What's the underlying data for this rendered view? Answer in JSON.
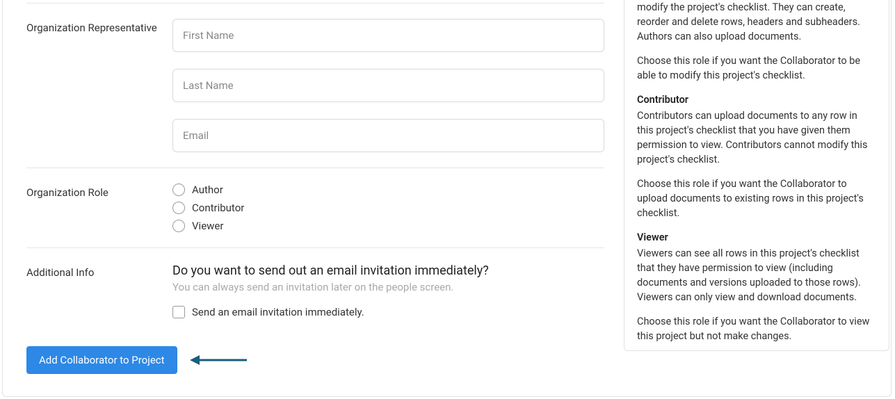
{
  "form": {
    "representative": {
      "label": "Organization Representative",
      "first_name_placeholder": "First Name",
      "first_name_value": "",
      "last_name_placeholder": "Last Name",
      "last_name_value": "",
      "email_placeholder": "Email",
      "email_value": ""
    },
    "role": {
      "label": "Organization Role",
      "options": {
        "author": "Author",
        "contributor": "Contributor",
        "viewer": "Viewer"
      }
    },
    "additional": {
      "label": "Additional Info",
      "question": "Do you want to send out an email invitation immediately?",
      "helper": "You can always send an invitation later on the people screen.",
      "checkbox_label": "Send an email invitation immediately."
    },
    "submit_label": "Add Collaborator to Project"
  },
  "help": {
    "author_partial": "modify the project's checklist. They can create, reorder and delete rows, headers and subheaders. Authors can also upload documents.",
    "author_choose": "Choose this role if you want the Collaborator to be able to modify this project's checklist.",
    "contributor_heading": "Contributor",
    "contributor_body": "Contributors can upload documents to any row in this project's checklist that you have given them permission to view. Contributors cannot modify this project's checklist.",
    "contributor_choose": "Choose this role if you want the Collaborator to upload documents to existing rows in this project's checklist.",
    "viewer_heading": "Viewer",
    "viewer_body": "Viewers can see all rows in this project's checklist that they have permission to view (including documents and versions uploaded to those rows). Viewers can only view and download documents.",
    "viewer_choose": "Choose this role if you want the Collaborator to view this project but not make changes."
  }
}
